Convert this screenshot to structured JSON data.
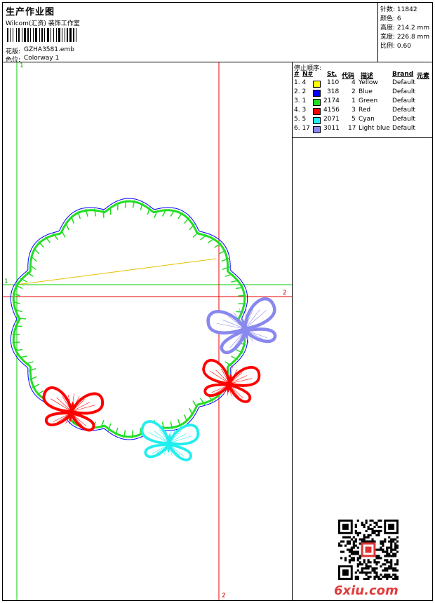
{
  "header": {
    "title": "生产作业图",
    "company": "Wilcom(汇资) 装饰工作室",
    "design_label": "花版:",
    "design_value": "GZHA3581.emb",
    "colorway_label": "色位:",
    "colorway_value": "Colorway 1"
  },
  "stats": [
    {
      "label": "针数:",
      "value": "11842"
    },
    {
      "label": "颜色:",
      "value": "6"
    },
    {
      "label": "高度:",
      "value": "214.2 mm"
    },
    {
      "label": "宽度:",
      "value": "226.8 mm"
    },
    {
      "label": "比例:",
      "value": "0.60"
    }
  ],
  "stop_sequence": {
    "heading": "停止顺序:",
    "columns": [
      "#",
      "N#",
      "St.",
      "代码",
      "描述",
      "Brand",
      "元素"
    ],
    "rows": [
      {
        "num": "1. 4",
        "color": "#ffff00",
        "stitches": "110",
        "code": "4",
        "desc": "Yellow",
        "brand": "Default"
      },
      {
        "num": "2. 2",
        "color": "#0000ff",
        "stitches": "318",
        "code": "2",
        "desc": "Blue",
        "brand": "Default"
      },
      {
        "num": "3. 1",
        "color": "#22dd22",
        "stitches": "2174",
        "code": "1",
        "desc": "Green",
        "brand": "Default"
      },
      {
        "num": "4. 3",
        "color": "#ff0000",
        "stitches": "4156",
        "code": "3",
        "desc": "Red",
        "brand": "Default"
      },
      {
        "num": "5. 5",
        "color": "#22eeee",
        "stitches": "2071",
        "code": "5",
        "desc": "Cyan",
        "brand": "Default"
      },
      {
        "num": "6. 17",
        "color": "#8888ee",
        "stitches": "3011",
        "code": "17",
        "desc": "Light blue",
        "brand": "Default"
      }
    ]
  },
  "axis_labels": {
    "top_v": "1",
    "left_h": "1",
    "right_h": "2",
    "bottom_v": "2"
  },
  "watermark": "6xiu.com",
  "colors": {
    "green_axis": "#00cc00",
    "red_axis": "#ee0000",
    "wreath_green": "#22dd22",
    "wreath_blue": "#0000ff"
  }
}
